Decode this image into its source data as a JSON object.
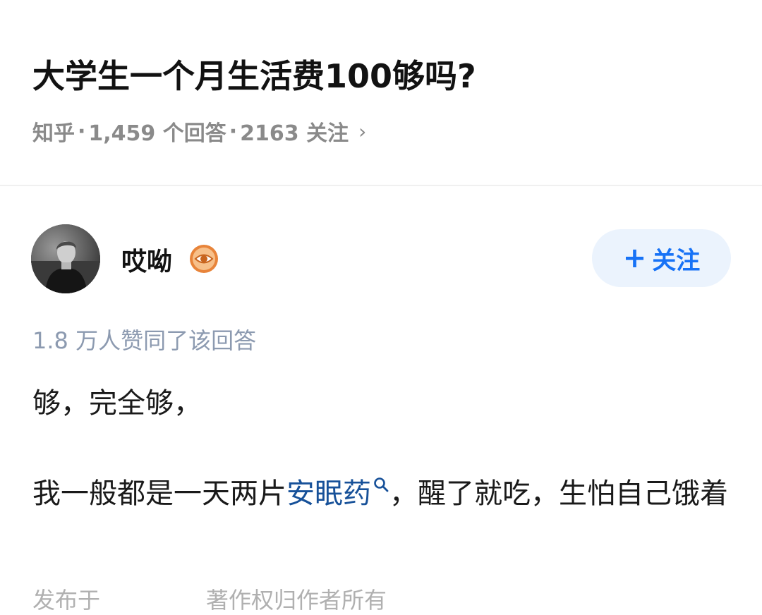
{
  "question": {
    "title": "大学生一个月生活费100够吗?",
    "meta_source": "知乎",
    "meta_answers": "1,459 个回答",
    "meta_follows": "2163 关注",
    "meta_separator": "·",
    "meta_chevron": "›"
  },
  "author": {
    "name": "哎呦",
    "follow_label": "关注",
    "follow_plus": "+",
    "avatar_icon": "avatar-photo",
    "badge_icon": "eye-badge-icon",
    "badge_color": "#e8843a"
  },
  "answer": {
    "upvotes": "1.8 万人赞同了该回答",
    "p1": "够，完全够，",
    "p2_before": "我一般都是一天两片",
    "p2_link": "安眠药",
    "p2_after": "，醒了就吃，生怕自己饿着",
    "cutoff_left": "发布于",
    "cutoff_right": "著作权归作者所有"
  },
  "colors": {
    "link": "#175199",
    "follow_text": "#1772f6",
    "follow_bg": "#ebf3fd",
    "meta": "#8a8a8a",
    "upvote": "#8c9ab0"
  }
}
